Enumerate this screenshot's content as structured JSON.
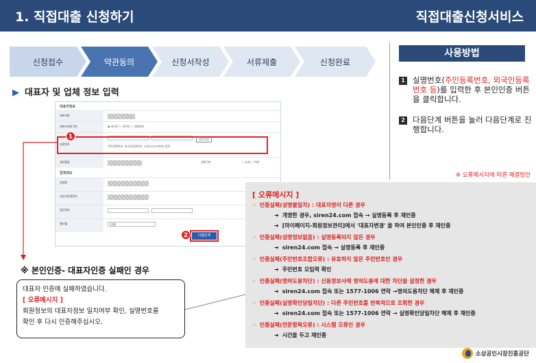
{
  "header": {
    "title": "1. 직접대출 신청하기",
    "service": "직접대출신청서비스"
  },
  "steps": [
    {
      "label": "신청접수",
      "state": "done"
    },
    {
      "label": "약관동의",
      "state": "active"
    },
    {
      "label": "신청서작성",
      "state": "todo"
    },
    {
      "label": "서류제출",
      "state": "todo"
    },
    {
      "label": "신청완료",
      "state": "todo"
    }
  ],
  "section_title": "대표자 및 업체 정보 입력",
  "form": {
    "group1": "대표자정보",
    "rows": [
      {
        "label": "대표자명",
        "value": ""
      },
      {
        "label": "대표자내외구분",
        "value": "◉ 내국인 ○ 외국인 ○ 재외동포"
      },
      {
        "label": "실명번호",
        "value": "주민등록번호, 외국인등록번호, 국내거소신고번호 입력",
        "button": "본인인증"
      },
      {
        "label": "생년월일",
        "value": "",
        "extra_label": "성별구분",
        "extra_value": "○ 남성 ○ 여성"
      }
    ],
    "group2": "업체정보",
    "rows2": [
      {
        "label": "업체명",
        "value": ""
      },
      {
        "label": "사업자등록번호",
        "value": ""
      },
      {
        "label": "법인번호",
        "value": ""
      },
      {
        "label": "결산월",
        "value": "12월"
      }
    ],
    "submit": "다음단계",
    "badge1": "1",
    "badge2": "2"
  },
  "sidebar": {
    "title": "사용방법",
    "items": [
      {
        "num": "1",
        "pre": "실명번호(",
        "highlight": "주민등록번호, 외국인등록번호 등",
        "post": ")를 입력한 후 본인인증 버튼을 클릭합니다."
      },
      {
        "num": "2",
        "text": "다음단계 버튼을 눌러 다음단계로 진행합니다."
      }
    ],
    "note": "※ 오류메시지에 따른 해결방안"
  },
  "errors": {
    "heading": "[ 오류메시지 ]",
    "l1": "인증실패(성명불일치) : 대표자명이 다른 경우",
    "l1a": "개명한 경우, siren24.com 접속 → 실명등록 후 재인증",
    "l1b": "[마이페이지-회원정보관리]에서 '대표자변경' 을 하여 본인인증 후 재인증",
    "l2": "인증실패(성명정보없음) : 실명등록되지 않은 경우",
    "l2a": "siren24.com 접속 → 실명등록 후 재인증",
    "l3": "인증실패(주민번호조합오류) : 유효하지 않은 주민번호인 경우",
    "l3a": "주민번호 오입력 확인",
    "l4": "인증실패(명의도용차단) : 신용정보사에 명의도용에 대한 차단을 설정한 경우",
    "l4a": "siren24.com 접속 또는 1577-1006 연락 →명의도용차단 해제 후 재인증",
    "l5": "인증실패(실명확인당일차단) : 다른 주민번호를 반복적으로 조회한 경우",
    "l5a": "siren24.com 접속 또는 1577-1006 연락 → 실명확인당일차단 해제 후 재인증",
    "l6": "인증실패(전문항목오류) : 시스템 오류인 경우",
    "l6a": "시간을 두고 재인증"
  },
  "fail": {
    "title": "※ 본인인증- 대표자인증 실패인 경우",
    "line1": "대표자 인증에 실패하였습니다.",
    "line2": "[ 오류메시지 ]",
    "line3": "회원정보의 대표자정보 일치여부 확인, 실명번호를",
    "line4": "확인 후 다시 인증해주십시오."
  },
  "footer": {
    "org": "소상공인시장진흥공단"
  },
  "colors": {
    "header": "#2a4a7a",
    "accent_red": "#e02020",
    "link_blue": "#1a56c4"
  }
}
